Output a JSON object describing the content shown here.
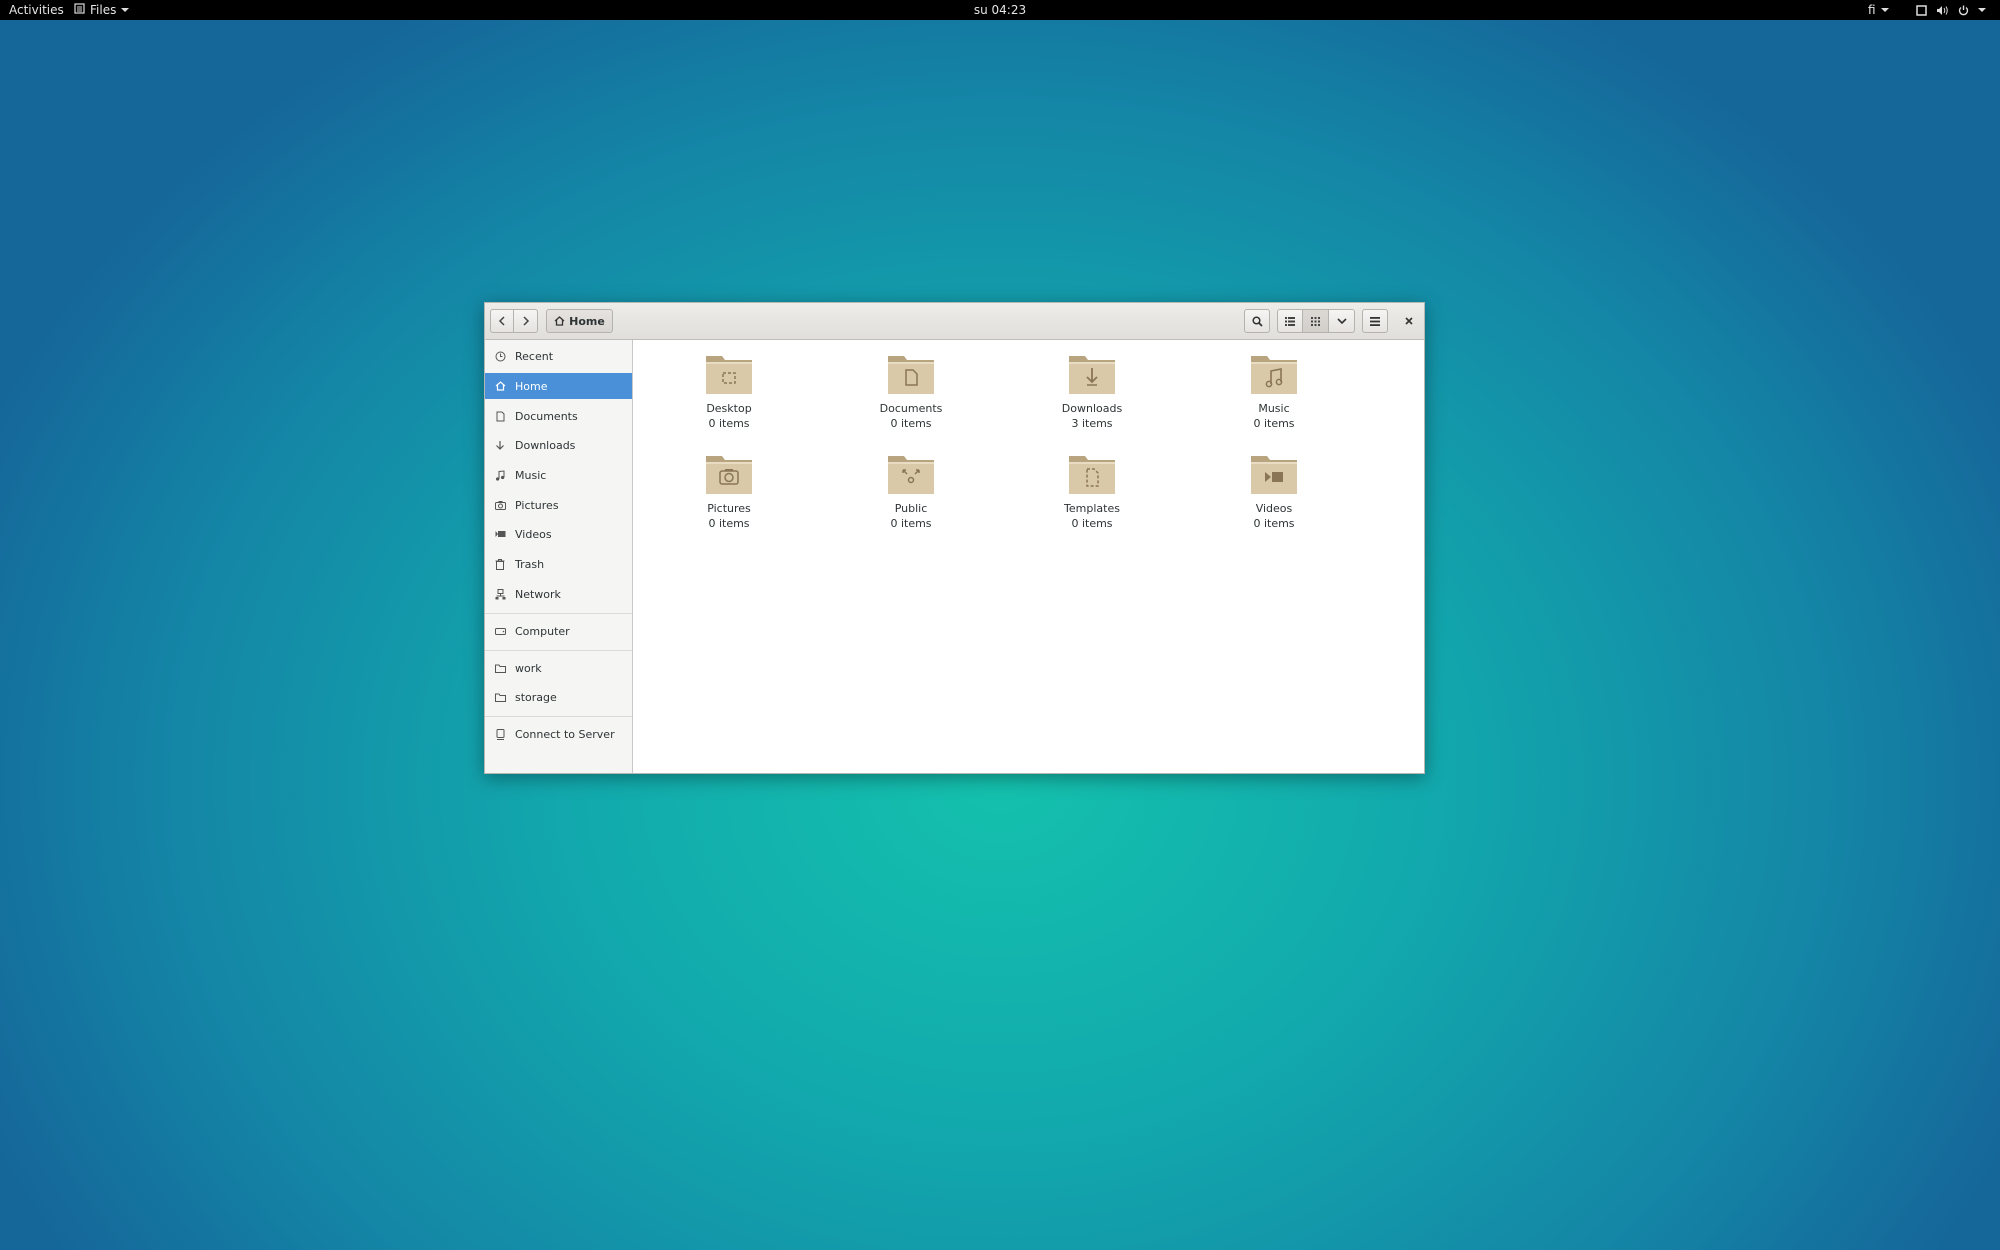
{
  "topbar": {
    "activities": "Activities",
    "app_menu": "Files",
    "clock": "su 04:23",
    "lang": "fi"
  },
  "window": {
    "location": "Home"
  },
  "sidebar": {
    "items": [
      {
        "label": "Recent",
        "icon": "clock-icon"
      },
      {
        "label": "Home",
        "icon": "home-icon"
      },
      {
        "label": "Documents",
        "icon": "document-icon"
      },
      {
        "label": "Downloads",
        "icon": "download-icon"
      },
      {
        "label": "Music",
        "icon": "music-icon"
      },
      {
        "label": "Pictures",
        "icon": "camera-icon"
      },
      {
        "label": "Videos",
        "icon": "video-icon"
      },
      {
        "label": "Trash",
        "icon": "trash-icon"
      },
      {
        "label": "Network",
        "icon": "network-icon"
      },
      {
        "label": "Computer",
        "icon": "drive-icon"
      },
      {
        "label": "work",
        "icon": "folder-icon"
      },
      {
        "label": "storage",
        "icon": "folder-icon"
      },
      {
        "label": "Connect to Server",
        "icon": "server-icon"
      }
    ],
    "active": "Home"
  },
  "files": [
    {
      "name": "Desktop",
      "count": "0 items",
      "emblem": "desktop"
    },
    {
      "name": "Documents",
      "count": "0 items",
      "emblem": "document"
    },
    {
      "name": "Downloads",
      "count": "3 items",
      "emblem": "download"
    },
    {
      "name": "Music",
      "count": "0 items",
      "emblem": "music"
    },
    {
      "name": "Pictures",
      "count": "0 items",
      "emblem": "camera"
    },
    {
      "name": "Public",
      "count": "0 items",
      "emblem": "share"
    },
    {
      "name": "Templates",
      "count": "0 items",
      "emblem": "template"
    },
    {
      "name": "Videos",
      "count": "0 items",
      "emblem": "video"
    }
  ],
  "colors": {
    "selection": "#4a90d9",
    "folder": "#d3c3a3",
    "topbar": "#000000"
  }
}
